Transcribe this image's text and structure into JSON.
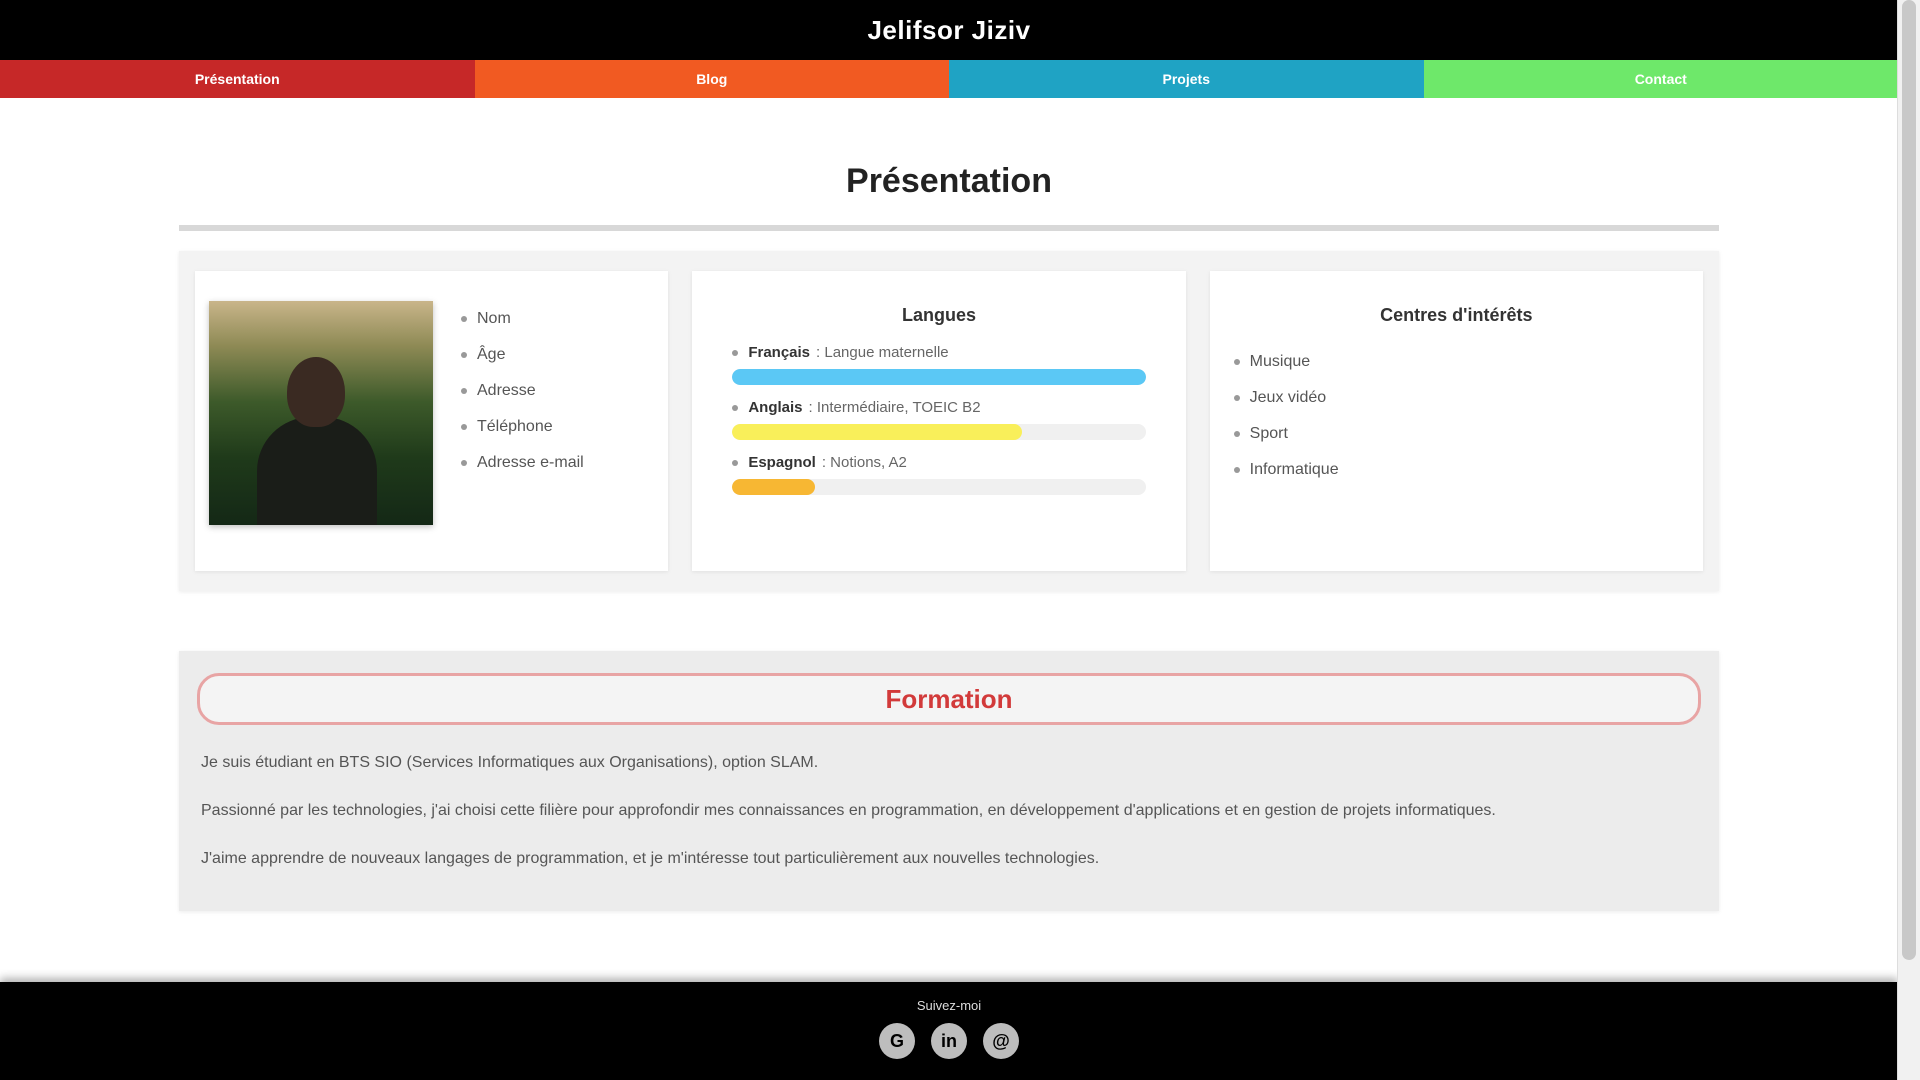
{
  "header": {
    "title": "Jelifsor Jiziv"
  },
  "nav": {
    "items": [
      {
        "label": "Présentation",
        "color": "#c62828"
      },
      {
        "label": "Blog",
        "color": "#f15a22"
      },
      {
        "label": "Projets",
        "color": "#1fa3c4"
      },
      {
        "label": "Contact",
        "color": "#6ee86a"
      }
    ]
  },
  "main": {
    "title": "Présentation",
    "profile": {
      "photo_icon": "profile-photo",
      "items": [
        "Nom",
        "Âge",
        "Adresse",
        "Téléphone",
        "Adresse e-mail"
      ]
    },
    "languages": {
      "heading": "Langues",
      "items": [
        {
          "name": "Français",
          "detail": ": Langue maternelle",
          "level": 1.0,
          "color": "#5bc8f5"
        },
        {
          "name": "Anglais",
          "detail": ": Intermédiaire, TOEIC B2",
          "level": 0.7,
          "color": "#f9ef5a"
        },
        {
          "name": "Espagnol",
          "detail": ": Notions, A2",
          "level": 0.2,
          "color": "#f7b733"
        }
      ]
    },
    "interests": {
      "heading": "Centres d'intérêts",
      "items": [
        "Musique",
        "Jeux vidéo",
        "Sport",
        "Informatique"
      ]
    },
    "formation": {
      "heading": "Formation",
      "paragraphs": [
        "Je suis étudiant en BTS SIO (Services Informatiques aux Organisations), option SLAM.",
        "Passionné par les technologies, j'ai choisi cette filière pour approfondir mes connaissances en programmation, en développement d'applications et en gestion de projets informatiques.",
        "J'aime apprendre de nouveaux langages de programmation, et je m'intéresse tout particulièrement aux nouvelles technologies."
      ]
    }
  },
  "footer": {
    "label": "Suivez-moi",
    "socials": [
      {
        "icon": "github-icon",
        "glyph": "G"
      },
      {
        "icon": "linkedin-icon",
        "glyph": "in"
      },
      {
        "icon": "mail-icon",
        "glyph": "@"
      }
    ]
  }
}
